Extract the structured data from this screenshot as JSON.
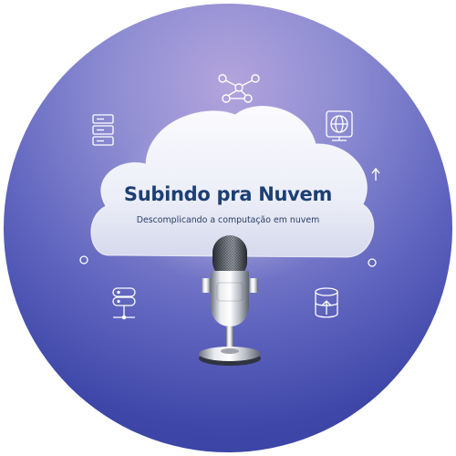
{
  "logo": {
    "title": "Subindo pra Nuvem",
    "subtitle": "Descomplicando a computação em nuvem"
  },
  "icons": [
    "network-nodes-icon",
    "server-rack-icon",
    "globe-icon",
    "arrow-up-icon",
    "circle-dot-icon",
    "database-network-icon",
    "database-upload-icon",
    "microphone-icon",
    "cloud-icon"
  ],
  "colors": {
    "background_top": "#b3a4dc",
    "background_bottom": "#37409f",
    "title": "#1c3f74",
    "cloud": "#eef0fa"
  }
}
